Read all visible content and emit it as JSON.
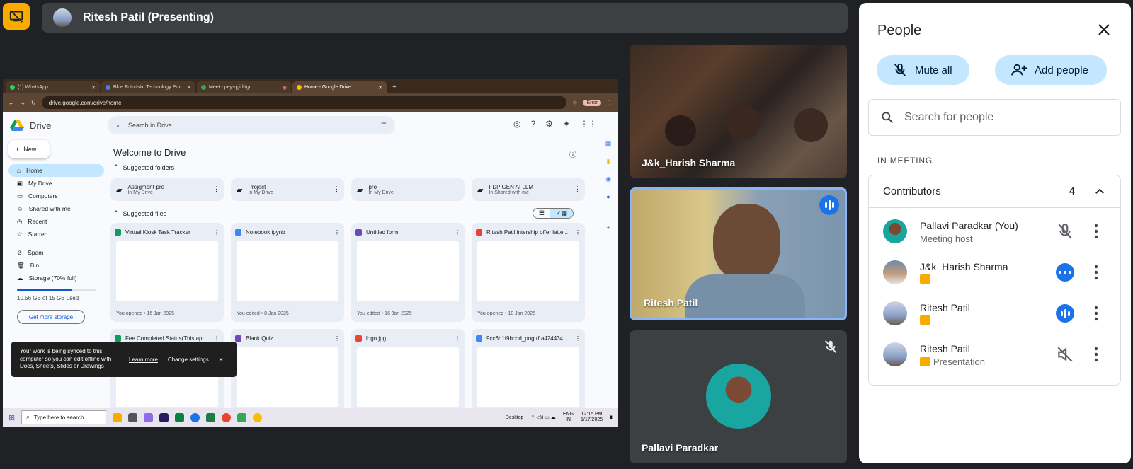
{
  "presenter_bar": {
    "title": "Ritesh Patil (Presenting)"
  },
  "browser": {
    "tabs": [
      "(1) WhatsApp",
      "Blue Futuristic Technology Pro...",
      "Meet - pey-qgid-tgr",
      "Home - Google Drive"
    ],
    "url": "drive.google.com/drive/home",
    "error_chip": "Error"
  },
  "drive": {
    "title": "Drive",
    "search_placeholder": "Search in Drive",
    "new_label": "New",
    "nav": [
      "Home",
      "My Drive",
      "Computers",
      "Shared with me",
      "Recent",
      "Starred",
      "Spam",
      "Bin",
      "Storage (70% full)"
    ],
    "storage_text": "10.56 GB of 15 GB used",
    "storage_fraction": 0.7,
    "get_storage": "Get more storage",
    "welcome": "Welcome to Drive",
    "suggested_folders": "Suggested folders",
    "folders": [
      {
        "name": "Assigment-pro",
        "loc": "In My Drive"
      },
      {
        "name": "Project",
        "loc": "In My Drive"
      },
      {
        "name": "pro",
        "loc": "In My Drive"
      },
      {
        "name": "FDP GEN AI LLM",
        "loc": "In Shared with me"
      }
    ],
    "suggested_files": "Suggested files",
    "files": [
      {
        "name": "Virtual Kiosk Task Tracker",
        "meta": "You opened • 16 Jan 2025",
        "color": "#0f9d58"
      },
      {
        "name": "Notebook.ipynb",
        "meta": "You edited • 8 Jan 2025",
        "color": "#4285f4"
      },
      {
        "name": "Untitled form",
        "meta": "You edited • 16 Jan 2025",
        "color": "#7248b9"
      },
      {
        "name": "Ritesh Patil intership offer lette...",
        "meta": "You opened • 10 Jan 2025",
        "color": "#ea4335"
      },
      {
        "name": "Fee Completed Status(This ap...",
        "meta": "",
        "color": "#0f9d58"
      },
      {
        "name": "Blank Quiz",
        "meta": "",
        "color": "#7248b9"
      },
      {
        "name": "logo.jpg",
        "meta": "",
        "color": "#ea4335"
      },
      {
        "name": "9cc6b1f9bcbd_png.rf.a424434...",
        "meta": "",
        "color": "#4285f4"
      }
    ],
    "toast": {
      "message": "Your work is being synced to this computer so you can edit offline with Docs, Sheets, Slides or Drawings",
      "learn": "Learn more",
      "change": "Change settings"
    }
  },
  "taskbar": {
    "search": "Type here to search",
    "desktop": "Desktop",
    "lang": "ENG",
    "region": "IN",
    "time": "12:15 PM",
    "date": "1/17/2025"
  },
  "tiles": [
    {
      "name": "J&k_Harish Sharma"
    },
    {
      "name": "Ritesh Patil"
    },
    {
      "name": "Pallavi Paradkar"
    }
  ],
  "people": {
    "title": "People",
    "mute_all": "Mute all",
    "add_people": "Add people",
    "search_placeholder": "Search for people",
    "in_meeting": "IN MEETING",
    "contributors_label": "Contributors",
    "contributors_count": "4",
    "list": [
      {
        "name": "Pallavi Paradkar (You)",
        "sub": "Meeting host"
      },
      {
        "name": "J&k_Harish Sharma",
        "sub": ""
      },
      {
        "name": "Ritesh Patil",
        "sub": ""
      },
      {
        "name": "Ritesh Patil",
        "sub": "Presentation"
      }
    ]
  }
}
